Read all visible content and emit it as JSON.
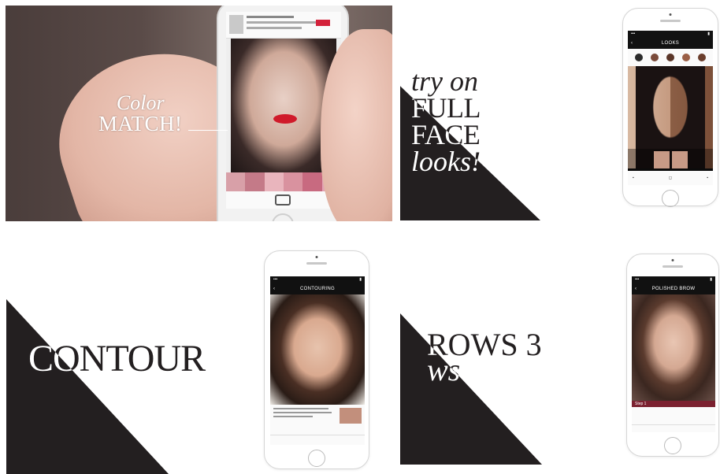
{
  "panel1": {
    "color_match_line1": "Color",
    "color_match_line2": "MATCH!"
  },
  "panel2": {
    "line1": "try on",
    "line2": "FULL FACE",
    "line3": "looks!"
  },
  "panel3": {
    "screen_title": "LOOKS"
  },
  "panel4": {
    "headline": "CONTOUR"
  },
  "panel5": {
    "screen_title": "CONTOURING"
  },
  "panel6": {
    "line1": "ROWS 3",
    "line2": "ws"
  },
  "panel7": {
    "screen_title": "POLISHED BROW",
    "step_label": "Step 1"
  },
  "colors": {
    "triangle_dark": "#231f20",
    "lipstick_red": "#d01a2a",
    "brow_step_band": "#7b2130",
    "swatches": [
      "#d8a0a8",
      "#c47a88",
      "#e9b5bd",
      "#d9929f",
      "#c86a80",
      "#e3a3b3"
    ]
  }
}
